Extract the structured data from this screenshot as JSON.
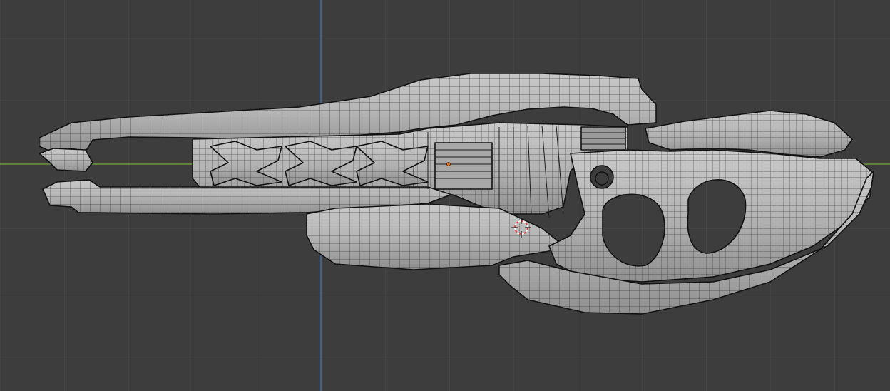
{
  "viewport": {
    "background": "#3d3d3d",
    "grid_color": "#4a4a4a",
    "x_axis_color": "#6f9a3b",
    "z_axis_color": "#3e6ea8"
  },
  "model": {
    "fill": "#b3b3b3",
    "wire_color": "#1c1c1c",
    "outline_color": "#111111"
  },
  "cursor_icon": "3d-cursor-icon",
  "origin_color": "#e8741f"
}
